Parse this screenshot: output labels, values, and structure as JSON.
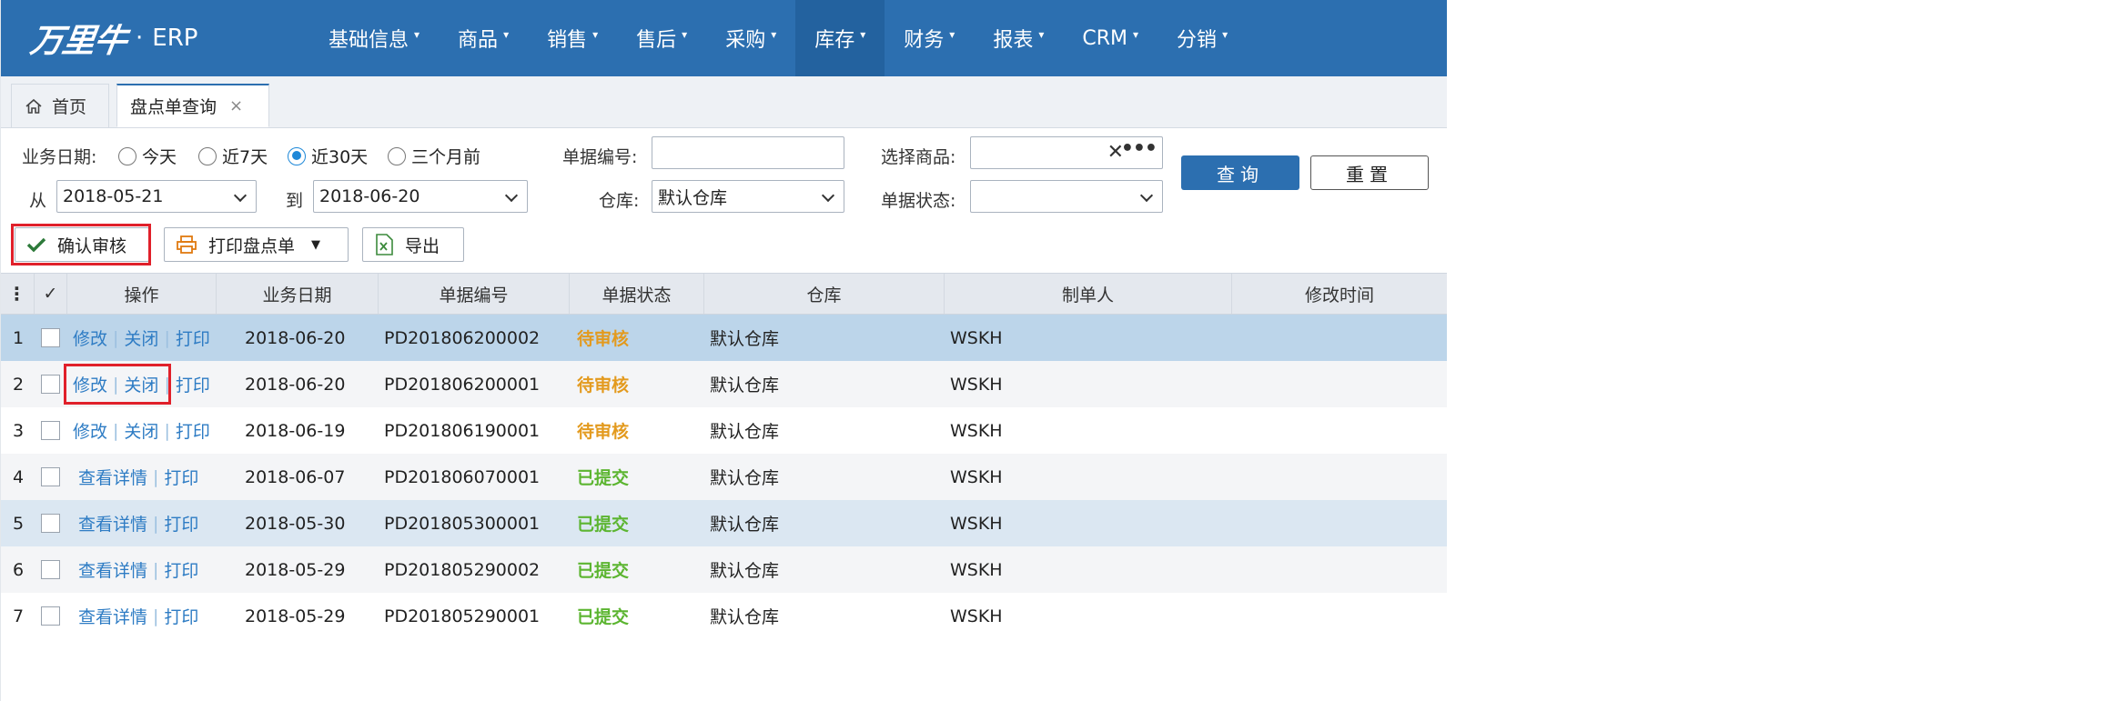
{
  "brand": {
    "logo": "万里牛",
    "dot": "·",
    "name": "ERP"
  },
  "nav": [
    {
      "label": "基础信息"
    },
    {
      "label": "商品"
    },
    {
      "label": "销售"
    },
    {
      "label": "售后"
    },
    {
      "label": "采购"
    },
    {
      "label": "库存",
      "active": true
    },
    {
      "label": "财务"
    },
    {
      "label": "报表"
    },
    {
      "label": "CRM"
    },
    {
      "label": "分销"
    }
  ],
  "tabs": {
    "home": "首页",
    "query": "盘点单查询",
    "close": "×"
  },
  "filters": {
    "date_label": "业务日期:",
    "radios": [
      "今天",
      "近7天",
      "近30天",
      "三个月前"
    ],
    "radio_selected": "近30天",
    "from_label": "从",
    "from_value": "2018-05-21",
    "to_label": "到",
    "to_value": "2018-06-20",
    "doc_no_label": "单据编号:",
    "doc_no_value": "",
    "warehouse_label": "仓库:",
    "warehouse_value": "默认仓库",
    "product_label": "选择商品:",
    "product_value": "",
    "status_label": "单据状态:",
    "status_value": "",
    "query_button": "查询",
    "reset_button": "重置"
  },
  "toolbar": {
    "confirm": "确认审核",
    "print": "打印盘点单",
    "export": "导出"
  },
  "grid": {
    "columns": [
      "操作",
      "业务日期",
      "单据编号",
      "单据状态",
      "仓库",
      "制单人",
      "修改时间"
    ],
    "check_all": "✓",
    "rows": [
      {
        "no": "1",
        "actions": [
          "修改",
          "关闭",
          "打印"
        ],
        "date": "2018-06-20",
        "doc": "PD201806200002",
        "status": "待审核",
        "warehouse": "默认仓库",
        "maker": "WSKH",
        "mtime": ""
      },
      {
        "no": "2",
        "actions": [
          "修改",
          "关闭",
          "打印"
        ],
        "date": "2018-06-20",
        "doc": "PD201806200001",
        "status": "待审核",
        "warehouse": "默认仓库",
        "maker": "WSKH",
        "mtime": ""
      },
      {
        "no": "3",
        "actions": [
          "修改",
          "关闭",
          "打印"
        ],
        "date": "2018-06-19",
        "doc": "PD201806190001",
        "status": "待审核",
        "warehouse": "默认仓库",
        "maker": "WSKH",
        "mtime": ""
      },
      {
        "no": "4",
        "actions": [
          "查看详情",
          "打印"
        ],
        "date": "2018-06-07",
        "doc": "PD201806070001",
        "status": "已提交",
        "warehouse": "默认仓库",
        "maker": "WSKH",
        "mtime": ""
      },
      {
        "no": "5",
        "actions": [
          "查看详情",
          "打印"
        ],
        "date": "2018-05-30",
        "doc": "PD201805300001",
        "status": "已提交",
        "warehouse": "默认仓库",
        "maker": "WSKH",
        "mtime": ""
      },
      {
        "no": "6",
        "actions": [
          "查看详情",
          "打印"
        ],
        "date": "2018-05-29",
        "doc": "PD201805290002",
        "status": "已提交",
        "warehouse": "默认仓库",
        "maker": "WSKH",
        "mtime": ""
      },
      {
        "no": "7",
        "actions": [
          "查看详情",
          "打印"
        ],
        "date": "2018-05-29",
        "doc": "PD201805290001",
        "status": "已提交",
        "warehouse": "默认仓库",
        "maker": "WSKH",
        "mtime": ""
      }
    ]
  },
  "colors": {
    "nav_bg": "#2c6fb0",
    "pending": "#e39a1e",
    "submitted": "#5cb531",
    "link": "#2e7cc4",
    "highlight": "#e0202a"
  }
}
